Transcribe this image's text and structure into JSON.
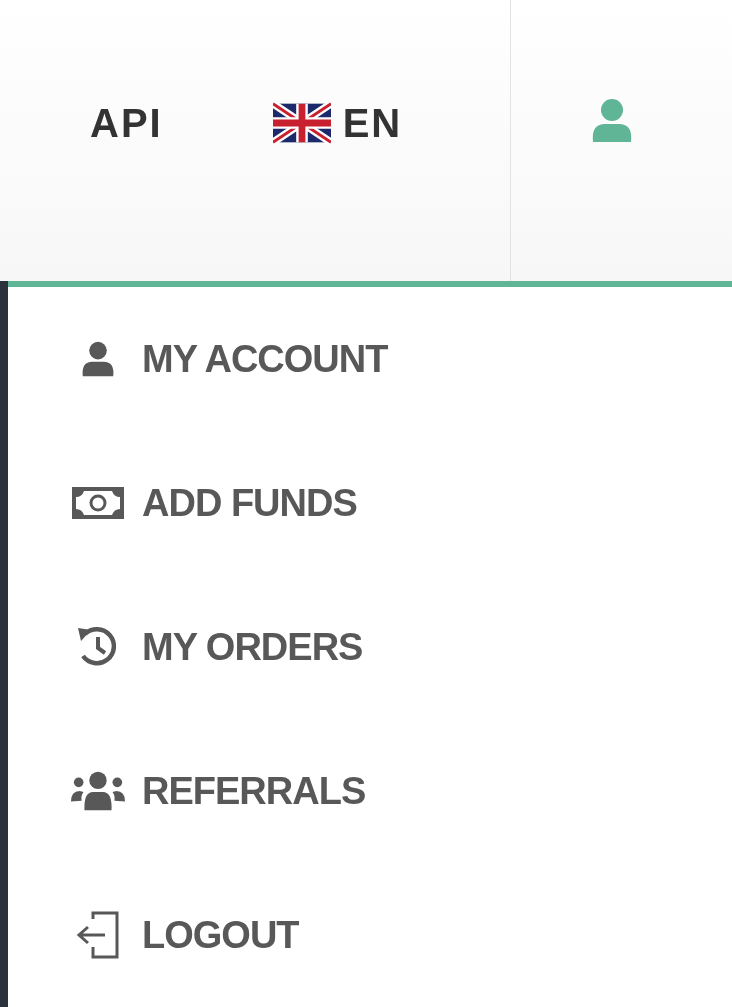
{
  "header": {
    "links": [
      {
        "label": "API"
      }
    ],
    "language": {
      "code": "EN"
    }
  },
  "account_menu": {
    "items": [
      {
        "kind": "account",
        "label": "MY ACCOUNT"
      },
      {
        "kind": "funds",
        "label": "ADD FUNDS"
      },
      {
        "kind": "orders",
        "label": "MY ORDERS"
      },
      {
        "kind": "referrals",
        "label": "REFERRALS"
      },
      {
        "kind": "logout",
        "label": "LOGOUT"
      }
    ]
  }
}
